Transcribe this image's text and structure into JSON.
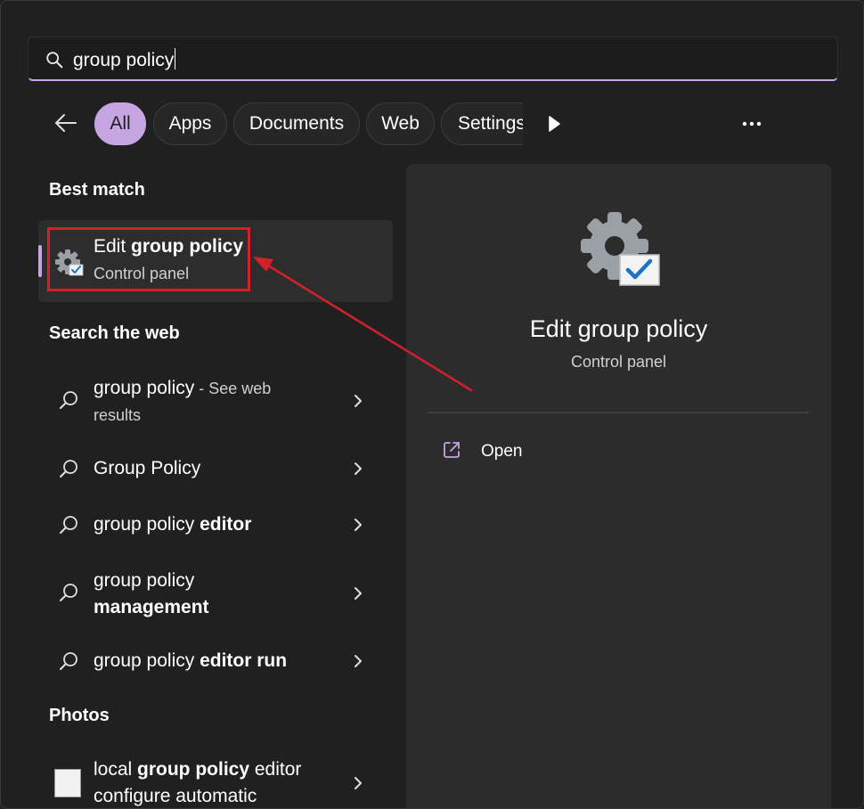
{
  "search": {
    "query": "group policy"
  },
  "filters": {
    "all": "All",
    "apps": "Apps",
    "documents": "Documents",
    "web": "Web",
    "settings": "Settings"
  },
  "best_match": {
    "heading": "Best match",
    "title_plain": "Edit ",
    "title_bold": "group policy",
    "subtitle": "Control panel"
  },
  "search_web": {
    "heading": "Search the web",
    "items": [
      {
        "plain": "group policy",
        "dim": " - See web",
        "line2": "results"
      },
      {
        "plain": "Group Policy"
      },
      {
        "plain": "group policy ",
        "bold": "editor"
      },
      {
        "plain": "group policy",
        "bold_line2": "management"
      },
      {
        "plain": "group policy ",
        "bold": "editor run"
      }
    ]
  },
  "photos": {
    "heading": "Photos",
    "item": {
      "plain": "local ",
      "bold": "group policy",
      "after": " editor",
      "line2": "configure automatic"
    }
  },
  "preview": {
    "title": "Edit group policy",
    "subtitle": "Control panel",
    "open_label": "Open"
  },
  "colors": {
    "accent": "#c7a5e3",
    "annotation_red": "#d4202a",
    "panel": "#2c2c2c",
    "background": "#202020"
  },
  "icons": [
    "search-icon",
    "back-arrow-icon",
    "play-arrow-icon",
    "more-dots-icon",
    "gear-check-icon",
    "chevron-right-icon",
    "open-external-icon"
  ]
}
